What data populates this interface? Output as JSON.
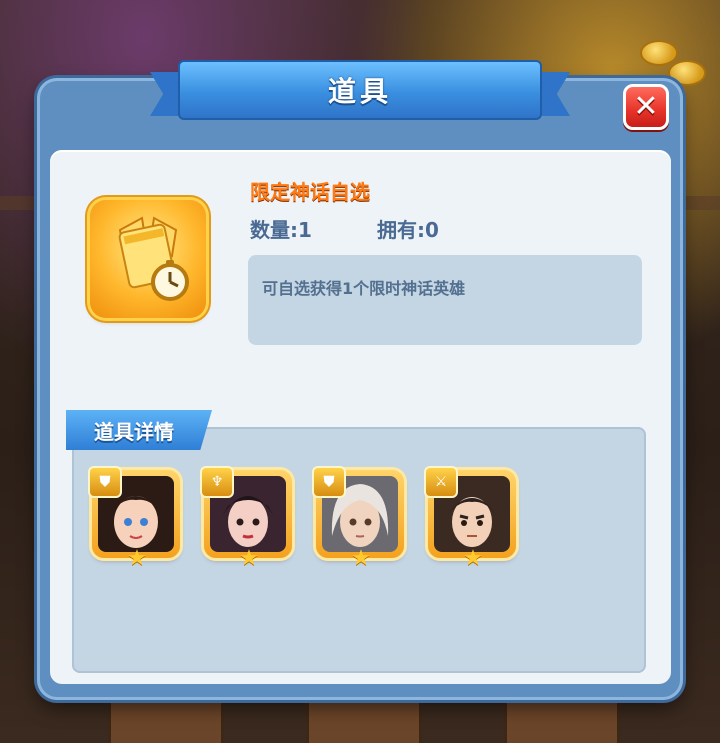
{
  "dialog": {
    "title": "道具",
    "close_label": "✕"
  },
  "item": {
    "icon": "mythic-hero-selector-icon",
    "name": "限定神话自选",
    "quantity_label": "数量:",
    "quantity_value": "1",
    "owned_label": "拥有:",
    "owned_value": "0",
    "description": "可自选获得1个限时神话英雄"
  },
  "details": {
    "tab_label": "道具详情",
    "heroes": [
      {
        "name": "hero-1",
        "badge_icon": "shield-icon",
        "stars": 1,
        "hair": "#2b1b14",
        "skin": "#f6d2bd"
      },
      {
        "name": "hero-2",
        "badge_icon": "staff-icon",
        "stars": 1,
        "hair": "#1f1418",
        "skin": "#f4cfc6"
      },
      {
        "name": "hero-3",
        "badge_icon": "shield-icon",
        "stars": 1,
        "hair": "#e9e4df",
        "skin": "#f1d4bf"
      },
      {
        "name": "hero-4",
        "badge_icon": "sword-icon",
        "stars": 1,
        "hair": "#2a2220",
        "skin": "#f3d1b8"
      }
    ]
  },
  "colors": {
    "accent_orange": "#ff7a12",
    "frame_blue": "#5f8fc0",
    "stat_text": "#4a6a94",
    "close_red": "#e6332a"
  }
}
